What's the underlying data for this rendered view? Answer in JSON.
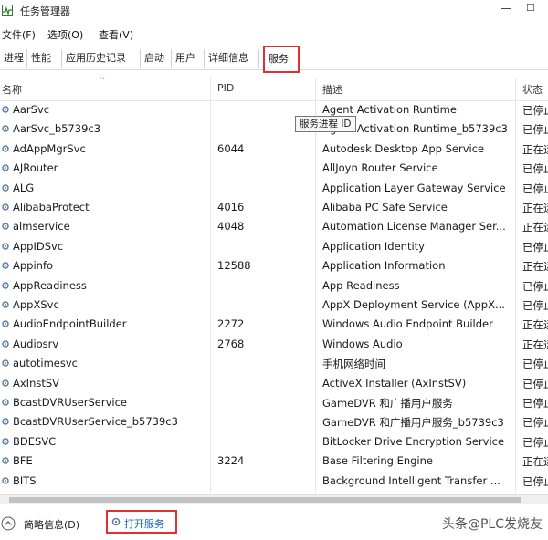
{
  "window": {
    "title": "任务管理器"
  },
  "menu": [
    "文件(F)",
    "选项(O)",
    "查看(V)"
  ],
  "tabs": [
    "进程",
    "性能",
    "应用历史记录",
    "启动",
    "用户",
    "详细信息",
    "服务"
  ],
  "active_tab": 6,
  "columns": {
    "name": "名称",
    "pid": "PID",
    "desc": "描述",
    "status": "状态"
  },
  "tooltip": "服务进程 ID",
  "services": [
    {
      "name": "AarSvc",
      "pid": "",
      "desc": "Agent Activation Runtime",
      "status": "已停止"
    },
    {
      "name": "AarSvc_b5739c3",
      "pid": "",
      "desc": "Agent Activation Runtime_b5739c3",
      "status": "已停止"
    },
    {
      "name": "AdAppMgrSvc",
      "pid": "6044",
      "desc": "Autodesk Desktop App Service",
      "status": "正在运行"
    },
    {
      "name": "AJRouter",
      "pid": "",
      "desc": "AllJoyn Router Service",
      "status": "已停止"
    },
    {
      "name": "ALG",
      "pid": "",
      "desc": "Application Layer Gateway Service",
      "status": "已停止"
    },
    {
      "name": "AlibabaProtect",
      "pid": "4016",
      "desc": "Alibaba PC Safe Service",
      "status": "正在运行"
    },
    {
      "name": "almservice",
      "pid": "4048",
      "desc": "Automation License Manager Ser...",
      "status": "正在运行"
    },
    {
      "name": "AppIDSvc",
      "pid": "",
      "desc": "Application Identity",
      "status": "已停止"
    },
    {
      "name": "Appinfo",
      "pid": "12588",
      "desc": "Application Information",
      "status": "正在运行"
    },
    {
      "name": "AppReadiness",
      "pid": "",
      "desc": "App Readiness",
      "status": "已停止"
    },
    {
      "name": "AppXSvc",
      "pid": "",
      "desc": "AppX Deployment Service (AppX...",
      "status": "已停止"
    },
    {
      "name": "AudioEndpointBuilder",
      "pid": "2272",
      "desc": "Windows Audio Endpoint Builder",
      "status": "正在运行"
    },
    {
      "name": "Audiosrv",
      "pid": "2768",
      "desc": "Windows Audio",
      "status": "正在运行"
    },
    {
      "name": "autotimesvc",
      "pid": "",
      "desc": "手机网络时间",
      "status": "已停止"
    },
    {
      "name": "AxInstSV",
      "pid": "",
      "desc": "ActiveX Installer (AxInstSV)",
      "status": "已停止"
    },
    {
      "name": "BcastDVRUserService",
      "pid": "",
      "desc": "GameDVR 和广播用户服务",
      "status": "已停止"
    },
    {
      "name": "BcastDVRUserService_b5739c3",
      "pid": "",
      "desc": "GameDVR 和广播用户服务_b5739c3",
      "status": "已停止"
    },
    {
      "name": "BDESVC",
      "pid": "",
      "desc": "BitLocker Drive Encryption Service",
      "status": "已停止"
    },
    {
      "name": "BFE",
      "pid": "3224",
      "desc": "Base Filtering Engine",
      "status": "正在运行"
    },
    {
      "name": "BITS",
      "pid": "",
      "desc": "Background Intelligent Transfer ...",
      "status": "已停止"
    }
  ],
  "footer": {
    "fewer_details": "简略信息(D)",
    "open_services": "打开服务"
  },
  "watermark": "头条@PLC发烧友"
}
